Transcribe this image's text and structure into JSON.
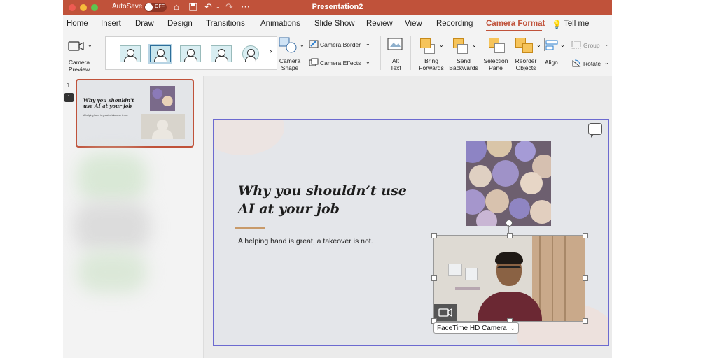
{
  "titlebar": {
    "autosave_label": "AutoSave",
    "autosave_state": "OFF",
    "document_title": "Presentation2",
    "icons": [
      "home-icon",
      "save-icon",
      "undo-icon",
      "redo-icon",
      "more-icon"
    ],
    "color": "#c0523a"
  },
  "tabs": [
    {
      "label": "Home"
    },
    {
      "label": "Insert"
    },
    {
      "label": "Draw"
    },
    {
      "label": "Design"
    },
    {
      "label": "Transitions"
    },
    {
      "label": "Animations"
    },
    {
      "label": "Slide Show"
    },
    {
      "label": "Review"
    },
    {
      "label": "View"
    },
    {
      "label": "Recording"
    },
    {
      "label": "Camera Format",
      "active": true
    },
    {
      "label": "Tell me"
    }
  ],
  "ribbon": {
    "camera_preview": "Camera\nPreview",
    "camera_shape": "Camera\nShape",
    "camera_border": "Camera Border",
    "camera_effects": "Camera Effects",
    "alt_text": "Alt\nText",
    "bring_forwards": "Bring\nForwards",
    "send_backwards": "Send\nBackwards",
    "selection_pane": "Selection\nPane",
    "reorder_objects": "Reorder\nObjects",
    "align": "Align",
    "group": "Group",
    "rotate": "Rotate",
    "gallery_styles": [
      "rectangle",
      "rectangle-selected",
      "rectangle",
      "rectangle",
      "circle"
    ]
  },
  "thumbnail_pane": {
    "slide_number": "1",
    "comment_count": "1",
    "thumb_title": "Why you shouldn't use AI at your job",
    "thumb_subtitle": "A helping hand is great, a takeover is not."
  },
  "slide": {
    "title": "Why you shouldn’t use AI at your job",
    "subtitle": "A helping hand is great, a takeover is not.",
    "camera_source": "FaceTime HD Camera"
  },
  "colors": {
    "accent": "#c0523a",
    "selection": "#6c6ad0"
  }
}
